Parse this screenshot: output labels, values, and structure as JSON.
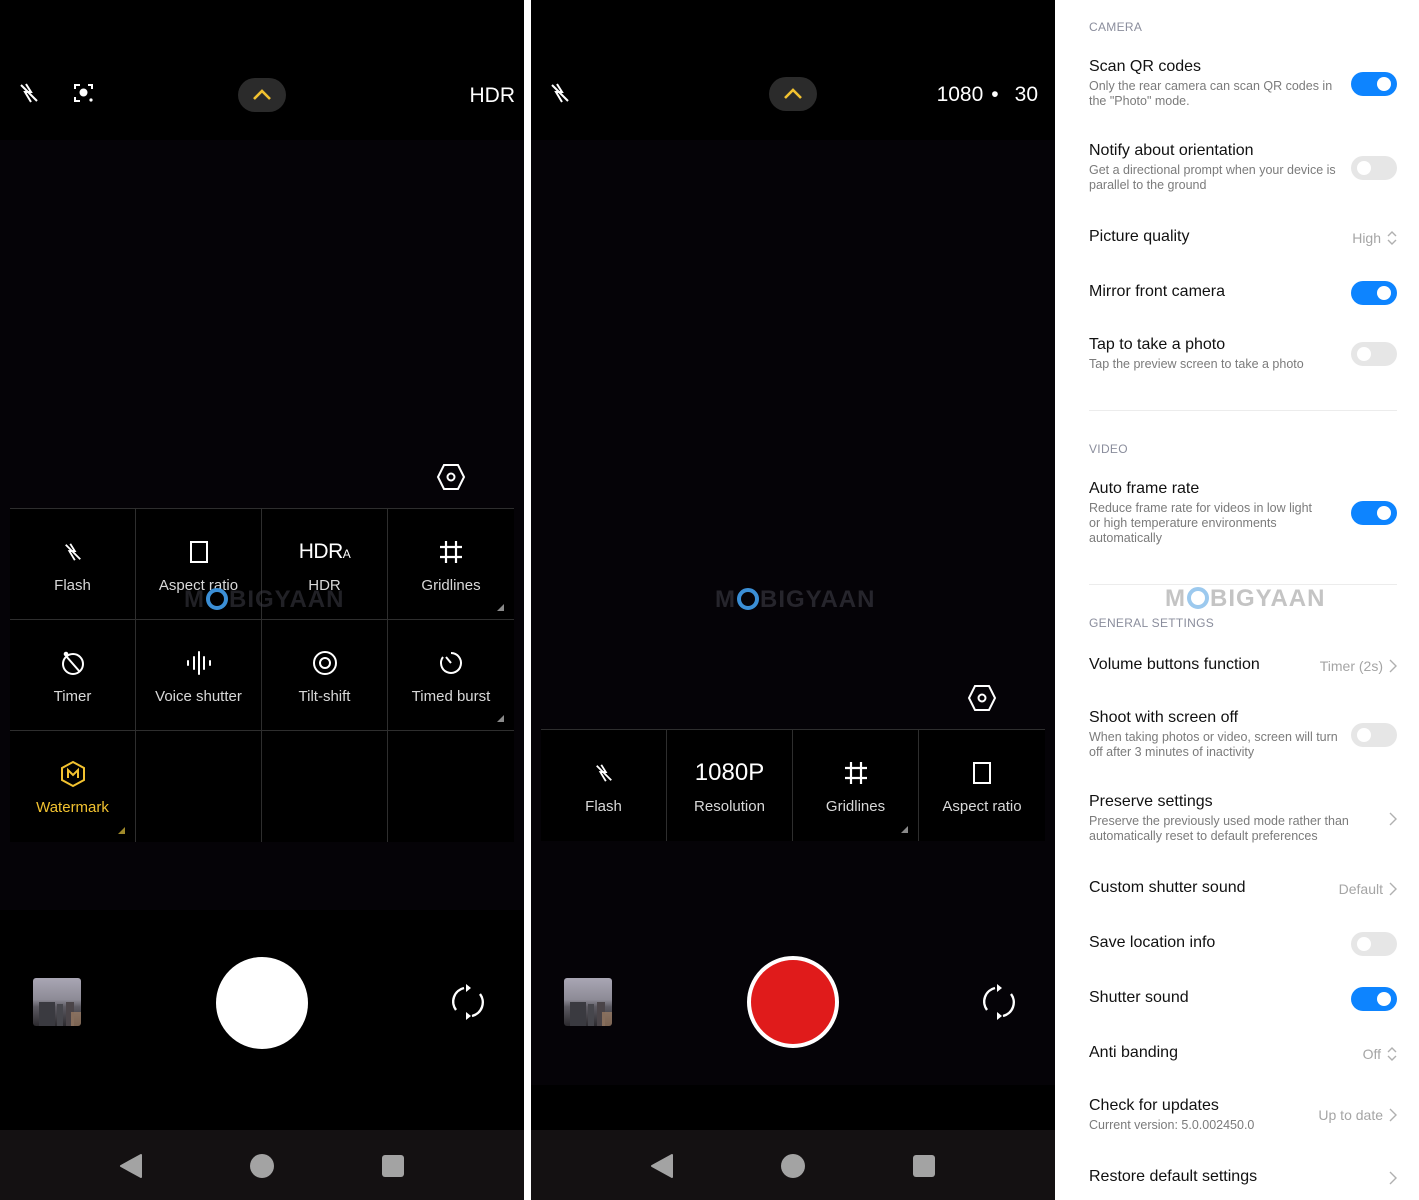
{
  "photo_screen": {
    "top_bar": {
      "flash_icon": "flash-off-icon",
      "focus_icon": "scan-focus-icon",
      "expand_icon": "chevron-up-icon",
      "hdr_label": "HDR"
    },
    "lens_icon": "hexagon-lens-icon",
    "quick_settings": [
      {
        "label": "Flash",
        "icon": "flash-off-icon",
        "active": false,
        "has_submenu": false
      },
      {
        "label": "Aspect ratio",
        "icon": "aspect-ratio-icon",
        "active": false,
        "has_submenu": false
      },
      {
        "label": "HDR",
        "icon": "hdr-auto-icon",
        "glyph": "HDR",
        "glyph_sub": "A",
        "active": false,
        "has_submenu": false
      },
      {
        "label": "Gridlines",
        "icon": "gridlines-icon",
        "active": false,
        "has_submenu": true
      },
      {
        "label": "Timer",
        "icon": "timer-off-icon",
        "active": false,
        "has_submenu": false
      },
      {
        "label": "Voice shutter",
        "icon": "voice-wave-icon",
        "active": false,
        "has_submenu": false
      },
      {
        "label": "Tilt-shift",
        "icon": "tilt-shift-icon",
        "active": false,
        "has_submenu": false
      },
      {
        "label": "Timed burst",
        "icon": "timed-burst-icon",
        "active": false,
        "has_submenu": true
      },
      {
        "label": "Watermark",
        "icon": "watermark-icon",
        "active": true,
        "has_submenu": true
      }
    ],
    "controls": {
      "gallery_icon": "gallery-thumbnail",
      "shutter": "shutter-button",
      "switch_camera_icon": "switch-camera-icon"
    }
  },
  "video_screen": {
    "top_bar": {
      "flash_icon": "flash-off-icon",
      "expand_icon": "chevron-up-icon",
      "resolution": "1080",
      "separator": "•",
      "fps": "30"
    },
    "lens_icon": "hexagon-lens-icon",
    "quick_settings": [
      {
        "label": "Flash",
        "icon": "flash-off-icon",
        "has_submenu": false
      },
      {
        "label": "Resolution",
        "icon": "resolution-text",
        "glyph": "1080P",
        "has_submenu": false
      },
      {
        "label": "Gridlines",
        "icon": "gridlines-icon",
        "has_submenu": true
      },
      {
        "label": "Aspect ratio",
        "icon": "aspect-ratio-icon",
        "has_submenu": false
      }
    ]
  },
  "watermark": {
    "before": "M",
    "after": "BIGYAAN"
  },
  "nav": {
    "back": "back-icon",
    "home": "home-icon",
    "recents": "recents-icon"
  },
  "settings": {
    "sections": {
      "camera": "CAMERA",
      "video": "VIDEO",
      "general": "GENERAL SETTINGS"
    },
    "camera_items": [
      {
        "title": "Scan QR codes",
        "desc": "Only the rear camera can scan QR codes in the \"Photo\" mode.",
        "control": "toggle",
        "on": true
      },
      {
        "title": "Notify about orientation",
        "desc": "Get a directional prompt when your device is parallel to the ground",
        "control": "toggle",
        "on": false
      },
      {
        "title": "Picture quality",
        "desc": "",
        "control": "select",
        "value": "High"
      },
      {
        "title": "Mirror front camera",
        "desc": "",
        "control": "toggle",
        "on": true
      },
      {
        "title": "Tap to take a photo",
        "desc": "Tap the preview screen to take a photo",
        "control": "toggle",
        "on": false
      }
    ],
    "video_items": [
      {
        "title": "Auto frame rate",
        "desc": "Reduce frame rate for videos in low light or high temperature environments automatically",
        "control": "toggle",
        "on": true
      }
    ],
    "general_items": [
      {
        "title": "Volume buttons function",
        "desc": "",
        "control": "link",
        "value": "Timer (2s)"
      },
      {
        "title": "Shoot with screen off",
        "desc": "When taking photos or video, screen will turn off after 3 minutes of inactivity",
        "control": "toggle",
        "on": false
      },
      {
        "title": "Preserve settings",
        "desc": "Preserve the previously used mode rather than automatically reset to default preferences",
        "control": "link",
        "value": ""
      },
      {
        "title": "Custom shutter sound",
        "desc": "",
        "control": "link",
        "value": "Default"
      },
      {
        "title": "Save location info",
        "desc": "",
        "control": "toggle",
        "on": false
      },
      {
        "title": "Shutter sound",
        "desc": "",
        "control": "toggle",
        "on": true
      },
      {
        "title": "Anti banding",
        "desc": "",
        "control": "select",
        "value": "Off"
      },
      {
        "title": "Check for updates",
        "desc": "Current version: 5.0.002450.0",
        "control": "link",
        "value": "Up to date"
      },
      {
        "title": "Restore default settings",
        "desc": "",
        "control": "link",
        "value": ""
      }
    ],
    "colors": {
      "toggle_on": "#0d84ff",
      "toggle_off": "#e6e6e6",
      "section_header": "#8a8d9c"
    }
  },
  "accent_color": "#f2c230",
  "record_color": "#e01b1b"
}
